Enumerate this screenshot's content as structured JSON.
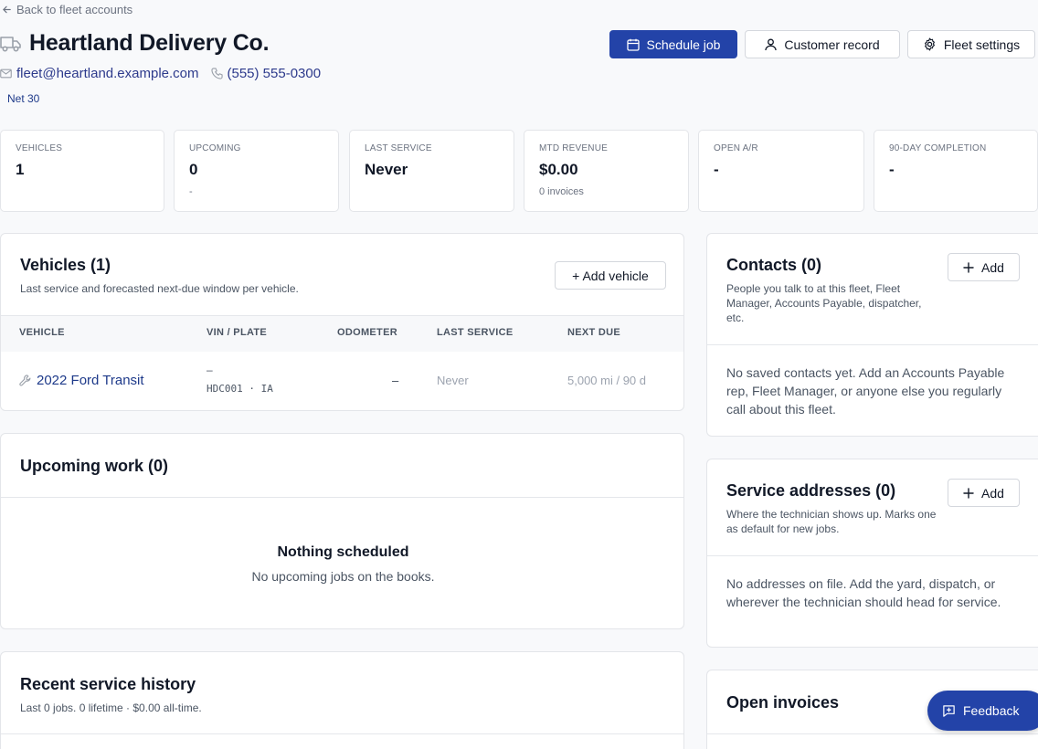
{
  "nav": {
    "back_label": "Back to fleet accounts"
  },
  "header": {
    "title": "Heartland Delivery Co.",
    "email": "fleet@heartland.example.com",
    "phone": "(555) 555-0300",
    "terms": "Net 30"
  },
  "actions": {
    "schedule_job": "Schedule job",
    "customer_record": "Customer record",
    "fleet_settings": "Fleet settings"
  },
  "stats": [
    {
      "label": "VEHICLES",
      "value": "1",
      "sub": ""
    },
    {
      "label": "UPCOMING",
      "value": "0",
      "sub": "-"
    },
    {
      "label": "LAST SERVICE",
      "value": "Never",
      "sub": ""
    },
    {
      "label": "MTD REVENUE",
      "value": "$0.00",
      "sub": "0 invoices"
    },
    {
      "label": "OPEN A/R",
      "value": "-",
      "sub": ""
    },
    {
      "label": "90-DAY COMPLETION",
      "value": "-",
      "sub": ""
    }
  ],
  "vehicles": {
    "title": "Vehicles (1)",
    "description": "Last service and forecasted next-due window per vehicle.",
    "add_label": "+ Add vehicle",
    "columns": [
      "VEHICLE",
      "VIN / PLATE",
      "ODOMETER",
      "LAST SERVICE",
      "NEXT DUE"
    ],
    "rows": [
      {
        "name": "2022 Ford Transit",
        "vin": "–",
        "plate": "HDC001 · IA",
        "odometer": "–",
        "last_service": "Never",
        "next_due": "5,000 mi / 90 d"
      }
    ]
  },
  "upcoming": {
    "title": "Upcoming work (0)",
    "empty_title": "Nothing scheduled",
    "empty_desc": "No upcoming jobs on the books."
  },
  "history": {
    "title": "Recent service history",
    "description": "Last 0 jobs. 0 lifetime · $0.00 all-time."
  },
  "contacts": {
    "title": "Contacts (0)",
    "description": "People you talk to at this fleet, Fleet Manager, Accounts Payable, dispatcher, etc.",
    "add_label": "Add",
    "empty": "No saved contacts yet. Add an Accounts Payable rep, Fleet Manager, or anyone else you regularly call about this fleet."
  },
  "addresses": {
    "title": "Service addresses (0)",
    "description": "Where the technician shows up. Marks one as default for new jobs.",
    "add_label": "Add",
    "empty": "No addresses on file. Add the yard, dispatch, or wherever the technician should head for service."
  },
  "invoices": {
    "title": "Open invoices"
  },
  "feedback": {
    "label": "Feedback"
  }
}
